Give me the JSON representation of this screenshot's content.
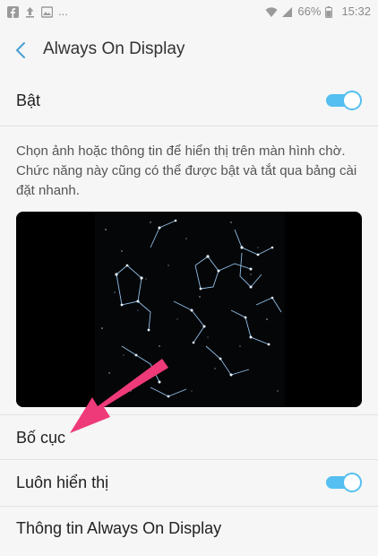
{
  "status_bar": {
    "icons_left": [
      "facebook-icon",
      "upload-icon",
      "image-icon"
    ],
    "more": "...",
    "battery": "66%",
    "time": "15:32"
  },
  "header": {
    "title": "Always On Display"
  },
  "master_switch": {
    "label": "Bật",
    "on": true
  },
  "description": "Chọn ảnh hoặc thông tin để hiển thị trên màn hình chờ. Chức năng này cũng có thể được bật và tắt qua bảng cài đặt nhanh.",
  "preview": {
    "image": "constellation-preview"
  },
  "items": {
    "layout": "Bố cục",
    "always_show": "Luôn hiển thị",
    "always_show_on": true,
    "info": "Thông tin Always On Display"
  },
  "colors": {
    "accent": "#54bff0",
    "annotation_arrow": "#ee3a78"
  }
}
